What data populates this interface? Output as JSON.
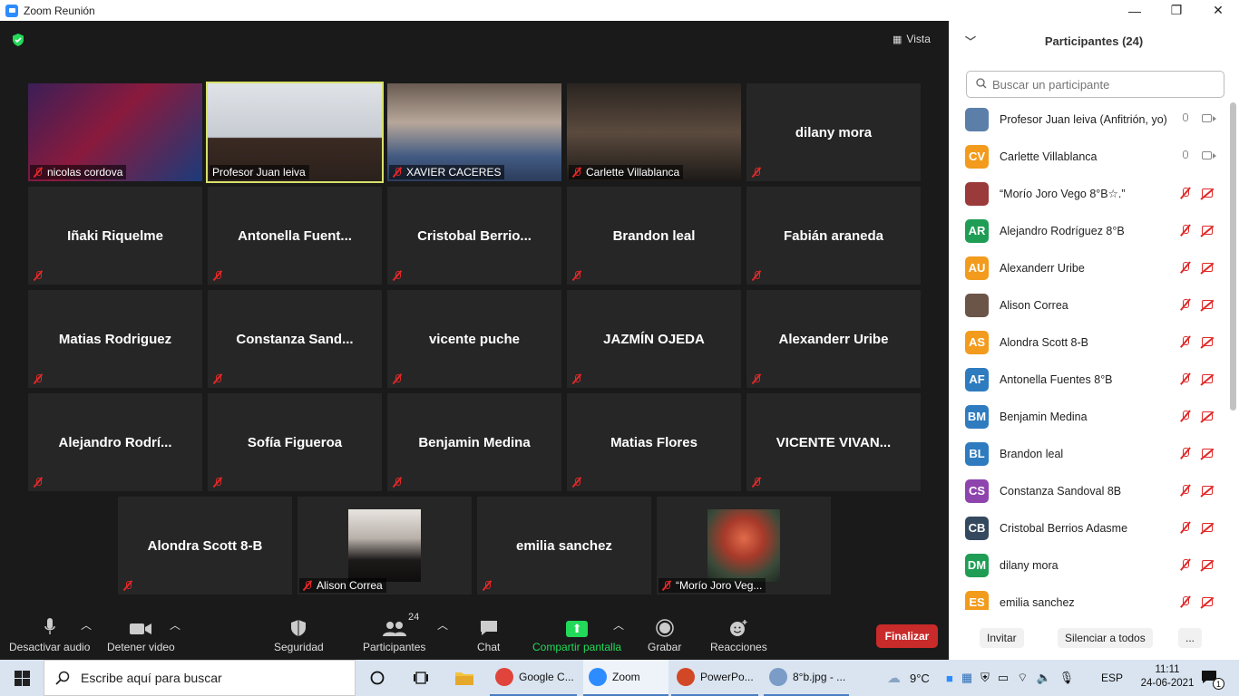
{
  "window": {
    "title": "Zoom Reunión",
    "minimize": "—",
    "maximize": "❐",
    "close": "✕"
  },
  "meeting": {
    "view_label": "Vista",
    "tiles": [
      {
        "name": "nicolas cordova",
        "type": "video"
      },
      {
        "name": "Profesor Juan leiva",
        "type": "video",
        "active": true
      },
      {
        "name": "XAVIER CACERES",
        "type": "video"
      },
      {
        "name": "Carlette Villablanca",
        "type": "video"
      },
      {
        "name": "dilany mora",
        "type": "name"
      },
      {
        "name": "Iñaki Riquelme",
        "type": "name"
      },
      {
        "name": "Antonella  Fuent...",
        "type": "name"
      },
      {
        "name": "Cristobal  Berrio...",
        "type": "name"
      },
      {
        "name": "Brandon leal",
        "type": "name"
      },
      {
        "name": "Fabián araneda",
        "type": "name"
      },
      {
        "name": "Matias Rodriguez",
        "type": "name"
      },
      {
        "name": "Constanza  Sand...",
        "type": "name"
      },
      {
        "name": "vicente puche",
        "type": "name"
      },
      {
        "name": "JAZMÍN OJEDA",
        "type": "name"
      },
      {
        "name": "Alexanderr Uribe",
        "type": "name"
      },
      {
        "name": "Alejandro  Rodrí...",
        "type": "name"
      },
      {
        "name": "Sofía Figueroa",
        "type": "name"
      },
      {
        "name": "Benjamin Medina",
        "type": "name"
      },
      {
        "name": "Matias Flores",
        "type": "name"
      },
      {
        "name": "VICENTE  VIVAN...",
        "type": "name"
      },
      {
        "name": "Alondra Scott 8-B",
        "type": "name"
      },
      {
        "name": "Alison Correa",
        "type": "photo"
      },
      {
        "name": "emilia sanchez",
        "type": "name"
      },
      {
        "name": "“Morío Joro Veg...",
        "type": "photo"
      }
    ]
  },
  "toolbar": {
    "audio": "Desactivar audio",
    "video": "Detener video",
    "security": "Seguridad",
    "participants": "Participantes",
    "participants_count": "24",
    "chat": "Chat",
    "share": "Compartir pantalla",
    "record": "Grabar",
    "reactions": "Reacciones",
    "end": "Finalizar"
  },
  "panel": {
    "title": "Participantes (24)",
    "search_placeholder": "Buscar un participante",
    "participants": [
      {
        "name": "Profesor Juan leiva (Anfitrión, yo)",
        "initials": "",
        "color": "#5b7fa8",
        "mic": "on",
        "cam": "on"
      },
      {
        "name": "Carlette Villablanca",
        "initials": "CV",
        "color": "#f29b1d",
        "mic": "on",
        "cam": "on"
      },
      {
        "name": "“Morío Joro Vego 8°B☆.”",
        "initials": "",
        "color": "#9a3a3a",
        "mic": "off",
        "cam": "off"
      },
      {
        "name": "Alejandro Rodríguez 8°B",
        "initials": "AR",
        "color": "#1f9d55",
        "mic": "off",
        "cam": "off"
      },
      {
        "name": "Alexanderr Uribe",
        "initials": "AU",
        "color": "#f29b1d",
        "mic": "off",
        "cam": "off"
      },
      {
        "name": "Alison Correa",
        "initials": "",
        "color": "#6b5548",
        "mic": "off",
        "cam": "off"
      },
      {
        "name": "Alondra Scott 8-B",
        "initials": "AS",
        "color": "#f29b1d",
        "mic": "off",
        "cam": "off"
      },
      {
        "name": "Antonella Fuentes 8°B",
        "initials": "AF",
        "color": "#2e7bbf",
        "mic": "off",
        "cam": "off"
      },
      {
        "name": "Benjamin Medina",
        "initials": "BM",
        "color": "#2e7bbf",
        "mic": "off",
        "cam": "off"
      },
      {
        "name": "Brandon leal",
        "initials": "BL",
        "color": "#2e7bbf",
        "mic": "off",
        "cam": "off"
      },
      {
        "name": "Constanza Sandoval 8B",
        "initials": "CS",
        "color": "#8e44ad",
        "mic": "off",
        "cam": "off"
      },
      {
        "name": "Cristobal Berrios Adasme",
        "initials": "CB",
        "color": "#34495e",
        "mic": "off",
        "cam": "off"
      },
      {
        "name": "dilany mora",
        "initials": "DM",
        "color": "#1f9d55",
        "mic": "off",
        "cam": "off"
      },
      {
        "name": "emilia sanchez",
        "initials": "ES",
        "color": "#f29b1d",
        "mic": "off",
        "cam": "off"
      }
    ],
    "invite": "Invitar",
    "mute_all": "Silenciar a todos",
    "more": "..."
  },
  "taskbar": {
    "search_placeholder": "Escribe aquí para buscar",
    "apps": [
      {
        "label": "Google C...",
        "color": "#e0443a"
      },
      {
        "label": "Zoom",
        "color": "#2d8cff"
      },
      {
        "label": "PowerPo...",
        "color": "#d24726"
      },
      {
        "label": "8°b.jpg - ...",
        "color": "#7a9cc6"
      }
    ],
    "weather": "9°C",
    "lang": "ESP",
    "time": "11:11",
    "date": "24-06-2021",
    "notifications": "1"
  }
}
